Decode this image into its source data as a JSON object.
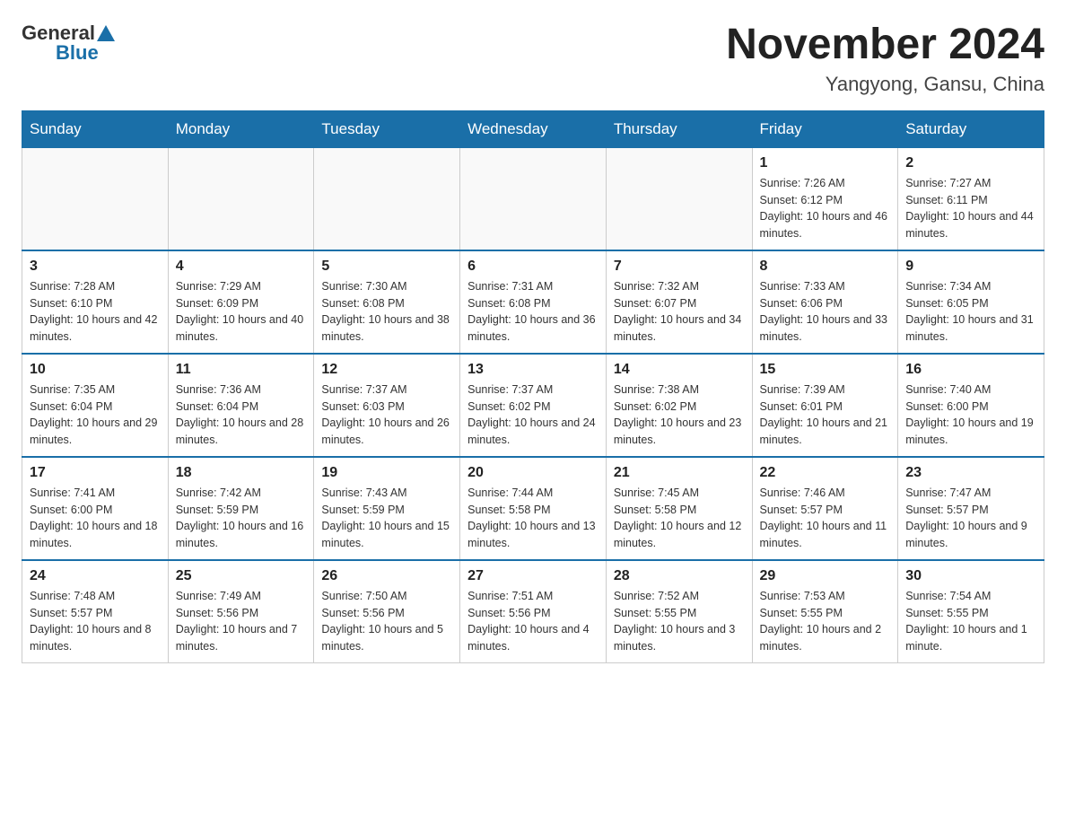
{
  "logo": {
    "general": "General",
    "blue": "Blue"
  },
  "title": "November 2024",
  "subtitle": "Yangyong, Gansu, China",
  "days_of_week": [
    "Sunday",
    "Monday",
    "Tuesday",
    "Wednesday",
    "Thursday",
    "Friday",
    "Saturday"
  ],
  "weeks": [
    [
      {
        "day": "",
        "info": ""
      },
      {
        "day": "",
        "info": ""
      },
      {
        "day": "",
        "info": ""
      },
      {
        "day": "",
        "info": ""
      },
      {
        "day": "",
        "info": ""
      },
      {
        "day": "1",
        "info": "Sunrise: 7:26 AM\nSunset: 6:12 PM\nDaylight: 10 hours and 46 minutes."
      },
      {
        "day": "2",
        "info": "Sunrise: 7:27 AM\nSunset: 6:11 PM\nDaylight: 10 hours and 44 minutes."
      }
    ],
    [
      {
        "day": "3",
        "info": "Sunrise: 7:28 AM\nSunset: 6:10 PM\nDaylight: 10 hours and 42 minutes."
      },
      {
        "day": "4",
        "info": "Sunrise: 7:29 AM\nSunset: 6:09 PM\nDaylight: 10 hours and 40 minutes."
      },
      {
        "day": "5",
        "info": "Sunrise: 7:30 AM\nSunset: 6:08 PM\nDaylight: 10 hours and 38 minutes."
      },
      {
        "day": "6",
        "info": "Sunrise: 7:31 AM\nSunset: 6:08 PM\nDaylight: 10 hours and 36 minutes."
      },
      {
        "day": "7",
        "info": "Sunrise: 7:32 AM\nSunset: 6:07 PM\nDaylight: 10 hours and 34 minutes."
      },
      {
        "day": "8",
        "info": "Sunrise: 7:33 AM\nSunset: 6:06 PM\nDaylight: 10 hours and 33 minutes."
      },
      {
        "day": "9",
        "info": "Sunrise: 7:34 AM\nSunset: 6:05 PM\nDaylight: 10 hours and 31 minutes."
      }
    ],
    [
      {
        "day": "10",
        "info": "Sunrise: 7:35 AM\nSunset: 6:04 PM\nDaylight: 10 hours and 29 minutes."
      },
      {
        "day": "11",
        "info": "Sunrise: 7:36 AM\nSunset: 6:04 PM\nDaylight: 10 hours and 28 minutes."
      },
      {
        "day": "12",
        "info": "Sunrise: 7:37 AM\nSunset: 6:03 PM\nDaylight: 10 hours and 26 minutes."
      },
      {
        "day": "13",
        "info": "Sunrise: 7:37 AM\nSunset: 6:02 PM\nDaylight: 10 hours and 24 minutes."
      },
      {
        "day": "14",
        "info": "Sunrise: 7:38 AM\nSunset: 6:02 PM\nDaylight: 10 hours and 23 minutes."
      },
      {
        "day": "15",
        "info": "Sunrise: 7:39 AM\nSunset: 6:01 PM\nDaylight: 10 hours and 21 minutes."
      },
      {
        "day": "16",
        "info": "Sunrise: 7:40 AM\nSunset: 6:00 PM\nDaylight: 10 hours and 19 minutes."
      }
    ],
    [
      {
        "day": "17",
        "info": "Sunrise: 7:41 AM\nSunset: 6:00 PM\nDaylight: 10 hours and 18 minutes."
      },
      {
        "day": "18",
        "info": "Sunrise: 7:42 AM\nSunset: 5:59 PM\nDaylight: 10 hours and 16 minutes."
      },
      {
        "day": "19",
        "info": "Sunrise: 7:43 AM\nSunset: 5:59 PM\nDaylight: 10 hours and 15 minutes."
      },
      {
        "day": "20",
        "info": "Sunrise: 7:44 AM\nSunset: 5:58 PM\nDaylight: 10 hours and 13 minutes."
      },
      {
        "day": "21",
        "info": "Sunrise: 7:45 AM\nSunset: 5:58 PM\nDaylight: 10 hours and 12 minutes."
      },
      {
        "day": "22",
        "info": "Sunrise: 7:46 AM\nSunset: 5:57 PM\nDaylight: 10 hours and 11 minutes."
      },
      {
        "day": "23",
        "info": "Sunrise: 7:47 AM\nSunset: 5:57 PM\nDaylight: 10 hours and 9 minutes."
      }
    ],
    [
      {
        "day": "24",
        "info": "Sunrise: 7:48 AM\nSunset: 5:57 PM\nDaylight: 10 hours and 8 minutes."
      },
      {
        "day": "25",
        "info": "Sunrise: 7:49 AM\nSunset: 5:56 PM\nDaylight: 10 hours and 7 minutes."
      },
      {
        "day": "26",
        "info": "Sunrise: 7:50 AM\nSunset: 5:56 PM\nDaylight: 10 hours and 5 minutes."
      },
      {
        "day": "27",
        "info": "Sunrise: 7:51 AM\nSunset: 5:56 PM\nDaylight: 10 hours and 4 minutes."
      },
      {
        "day": "28",
        "info": "Sunrise: 7:52 AM\nSunset: 5:55 PM\nDaylight: 10 hours and 3 minutes."
      },
      {
        "day": "29",
        "info": "Sunrise: 7:53 AM\nSunset: 5:55 PM\nDaylight: 10 hours and 2 minutes."
      },
      {
        "day": "30",
        "info": "Sunrise: 7:54 AM\nSunset: 5:55 PM\nDaylight: 10 hours and 1 minute."
      }
    ]
  ]
}
